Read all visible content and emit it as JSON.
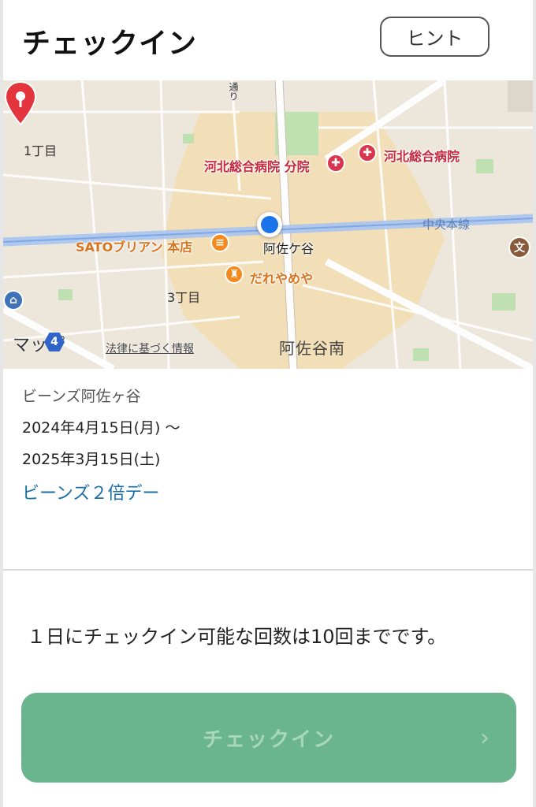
{
  "header": {
    "title": "チェックイン",
    "hint_label": "ヒント"
  },
  "map": {
    "labels": {
      "block1": "1丁目",
      "block3": "3丁目",
      "street": "通り",
      "asagaya_south": "阿佐谷南",
      "line": "中央本線"
    },
    "pois": {
      "hospital_branch": "河北総合病院 分院",
      "hospital": "河北総合病院",
      "restaurant": "SATOブリアン 本店",
      "shop": "だれやめや",
      "station": "阿佐ケ谷"
    },
    "attribution": {
      "logo": "マップ",
      "legal": "法律に基づく情報"
    },
    "route_badge": "4"
  },
  "info": {
    "shop_name": "ビーンズ阿佐ヶ谷",
    "period_start": "2024年4月15日(月) 〜",
    "period_end": "2025年3月15日(土)",
    "campaign": "ビーンズ２倍デー"
  },
  "notice": "１日にチェックイン可能な回数は10回までです。",
  "checkin_button": {
    "label": "チェックイン",
    "chevron": "›"
  },
  "colors": {
    "accent_green": "#6ab58d",
    "link_blue": "#1a6fa8",
    "hospital_red": "#d9354d",
    "food_orange": "#f28a1d"
  }
}
